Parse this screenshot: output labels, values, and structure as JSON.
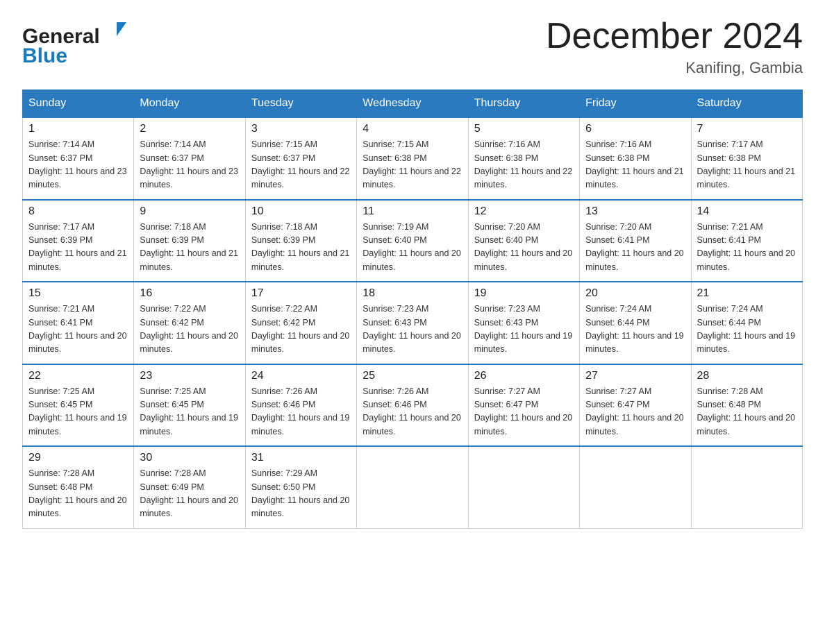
{
  "header": {
    "logo_general": "General",
    "logo_blue": "Blue",
    "month_title": "December 2024",
    "location": "Kanifing, Gambia"
  },
  "days_of_week": [
    "Sunday",
    "Monday",
    "Tuesday",
    "Wednesday",
    "Thursday",
    "Friday",
    "Saturday"
  ],
  "weeks": [
    [
      {
        "num": "1",
        "sunrise": "7:14 AM",
        "sunset": "6:37 PM",
        "daylight": "11 hours and 23 minutes."
      },
      {
        "num": "2",
        "sunrise": "7:14 AM",
        "sunset": "6:37 PM",
        "daylight": "11 hours and 23 minutes."
      },
      {
        "num": "3",
        "sunrise": "7:15 AM",
        "sunset": "6:37 PM",
        "daylight": "11 hours and 22 minutes."
      },
      {
        "num": "4",
        "sunrise": "7:15 AM",
        "sunset": "6:38 PM",
        "daylight": "11 hours and 22 minutes."
      },
      {
        "num": "5",
        "sunrise": "7:16 AM",
        "sunset": "6:38 PM",
        "daylight": "11 hours and 22 minutes."
      },
      {
        "num": "6",
        "sunrise": "7:16 AM",
        "sunset": "6:38 PM",
        "daylight": "11 hours and 21 minutes."
      },
      {
        "num": "7",
        "sunrise": "7:17 AM",
        "sunset": "6:38 PM",
        "daylight": "11 hours and 21 minutes."
      }
    ],
    [
      {
        "num": "8",
        "sunrise": "7:17 AM",
        "sunset": "6:39 PM",
        "daylight": "11 hours and 21 minutes."
      },
      {
        "num": "9",
        "sunrise": "7:18 AM",
        "sunset": "6:39 PM",
        "daylight": "11 hours and 21 minutes."
      },
      {
        "num": "10",
        "sunrise": "7:18 AM",
        "sunset": "6:39 PM",
        "daylight": "11 hours and 21 minutes."
      },
      {
        "num": "11",
        "sunrise": "7:19 AM",
        "sunset": "6:40 PM",
        "daylight": "11 hours and 20 minutes."
      },
      {
        "num": "12",
        "sunrise": "7:20 AM",
        "sunset": "6:40 PM",
        "daylight": "11 hours and 20 minutes."
      },
      {
        "num": "13",
        "sunrise": "7:20 AM",
        "sunset": "6:41 PM",
        "daylight": "11 hours and 20 minutes."
      },
      {
        "num": "14",
        "sunrise": "7:21 AM",
        "sunset": "6:41 PM",
        "daylight": "11 hours and 20 minutes."
      }
    ],
    [
      {
        "num": "15",
        "sunrise": "7:21 AM",
        "sunset": "6:41 PM",
        "daylight": "11 hours and 20 minutes."
      },
      {
        "num": "16",
        "sunrise": "7:22 AM",
        "sunset": "6:42 PM",
        "daylight": "11 hours and 20 minutes."
      },
      {
        "num": "17",
        "sunrise": "7:22 AM",
        "sunset": "6:42 PM",
        "daylight": "11 hours and 20 minutes."
      },
      {
        "num": "18",
        "sunrise": "7:23 AM",
        "sunset": "6:43 PM",
        "daylight": "11 hours and 20 minutes."
      },
      {
        "num": "19",
        "sunrise": "7:23 AM",
        "sunset": "6:43 PM",
        "daylight": "11 hours and 19 minutes."
      },
      {
        "num": "20",
        "sunrise": "7:24 AM",
        "sunset": "6:44 PM",
        "daylight": "11 hours and 19 minutes."
      },
      {
        "num": "21",
        "sunrise": "7:24 AM",
        "sunset": "6:44 PM",
        "daylight": "11 hours and 19 minutes."
      }
    ],
    [
      {
        "num": "22",
        "sunrise": "7:25 AM",
        "sunset": "6:45 PM",
        "daylight": "11 hours and 19 minutes."
      },
      {
        "num": "23",
        "sunrise": "7:25 AM",
        "sunset": "6:45 PM",
        "daylight": "11 hours and 19 minutes."
      },
      {
        "num": "24",
        "sunrise": "7:26 AM",
        "sunset": "6:46 PM",
        "daylight": "11 hours and 19 minutes."
      },
      {
        "num": "25",
        "sunrise": "7:26 AM",
        "sunset": "6:46 PM",
        "daylight": "11 hours and 20 minutes."
      },
      {
        "num": "26",
        "sunrise": "7:27 AM",
        "sunset": "6:47 PM",
        "daylight": "11 hours and 20 minutes."
      },
      {
        "num": "27",
        "sunrise": "7:27 AM",
        "sunset": "6:47 PM",
        "daylight": "11 hours and 20 minutes."
      },
      {
        "num": "28",
        "sunrise": "7:28 AM",
        "sunset": "6:48 PM",
        "daylight": "11 hours and 20 minutes."
      }
    ],
    [
      {
        "num": "29",
        "sunrise": "7:28 AM",
        "sunset": "6:48 PM",
        "daylight": "11 hours and 20 minutes."
      },
      {
        "num": "30",
        "sunrise": "7:28 AM",
        "sunset": "6:49 PM",
        "daylight": "11 hours and 20 minutes."
      },
      {
        "num": "31",
        "sunrise": "7:29 AM",
        "sunset": "6:50 PM",
        "daylight": "11 hours and 20 minutes."
      },
      null,
      null,
      null,
      null
    ]
  ],
  "labels": {
    "sunrise_prefix": "Sunrise: ",
    "sunset_prefix": "Sunset: ",
    "daylight_prefix": "Daylight: "
  }
}
